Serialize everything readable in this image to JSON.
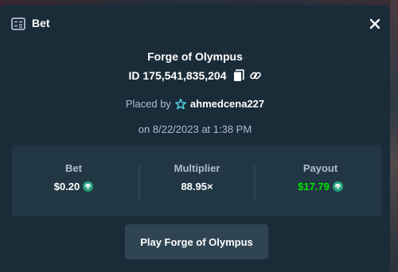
{
  "modal": {
    "title": "Bet",
    "close_icon": "close-icon",
    "title_icon": "bet-slip-icon"
  },
  "game": {
    "name": "Forge of Olympus",
    "bet_id": "ID 175,541,835,204"
  },
  "placement": {
    "placed_by_label": "Placed by",
    "username": "ahmedcena227",
    "user_icon": "star-badge-icon",
    "date_text": "on 8/22/2023 at 1:38 PM"
  },
  "stats": {
    "bet_label": "Bet",
    "bet_value": "$0.20",
    "multiplier_label": "Multiplier",
    "multiplier_value": "88.95×",
    "payout_label": "Payout",
    "payout_value": "$17.79",
    "currency_icon": "tether-coin-icon",
    "payout_color": "#00e701"
  },
  "actions": {
    "play_label": "Play Forge of Olympus"
  },
  "colors": {
    "background": "#1a2c38",
    "panel": "#213743",
    "button": "#2f4553",
    "muted_text": "#b1bad3",
    "coin": "#26a17b"
  }
}
